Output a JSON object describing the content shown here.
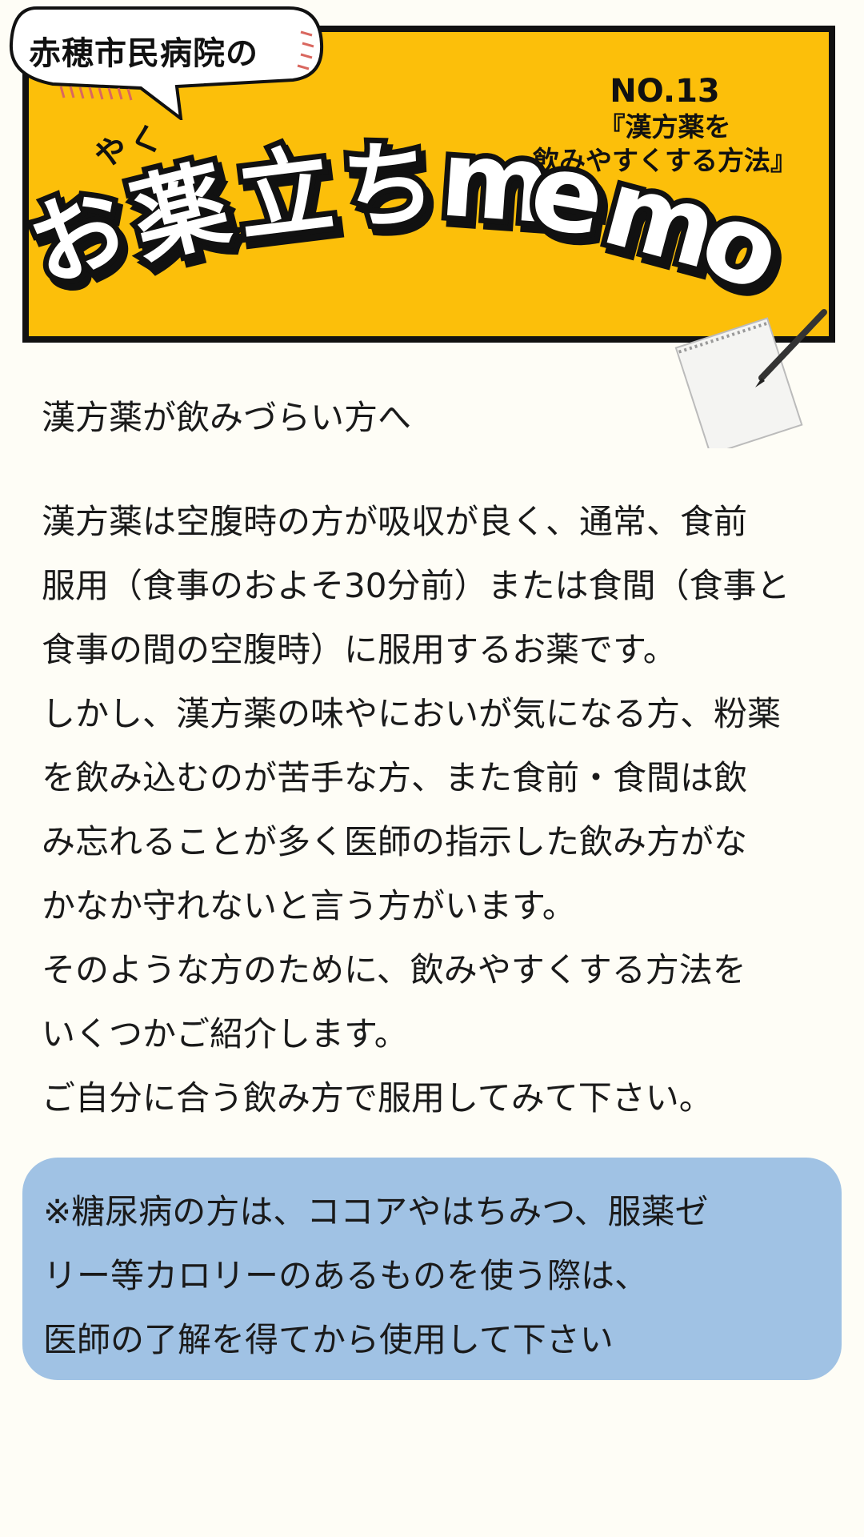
{
  "header": {
    "bubble_text": "赤穂市民病院の",
    "issue_no": "NO.13",
    "issue_title_line1": "『漢方薬を",
    "issue_title_line2": "飲みやすくする方法』",
    "ruby": "やく",
    "logo_chars": [
      "お",
      "薬",
      "立",
      "ち",
      "m",
      "e",
      "m",
      "o"
    ],
    "accent_color": "#fcbf0a"
  },
  "intro": "漢方薬が飲みづらい方へ",
  "body_lines": [
    "漢方薬は空腹時の方が吸収が良く、通常、食前",
    "服用（食事のおよそ30分前）または食間（食事と",
    "食事の間の空腹時）に服用するお薬です。",
    "しかし、漢方薬の味やにおいが気になる方、粉薬",
    "を飲み込むのが苦手な方、また食前・食間は飲",
    "み忘れることが多く医師の指示した飲み方がな",
    "かなか守れないと言う方がいます。",
    "そのような方のために、飲みやすくする方法を",
    "いくつかご紹介します。",
    "ご自分に合う飲み方で服用してみて下さい。"
  ],
  "notice": {
    "lines": [
      "※糖尿病の方は、ココアやはちみつ、服薬ゼ",
      "リー等カロリーのあるものを使う際は、",
      "医師の了解を得てから使用して下さい"
    ],
    "background_color": "#a0c2e4"
  }
}
